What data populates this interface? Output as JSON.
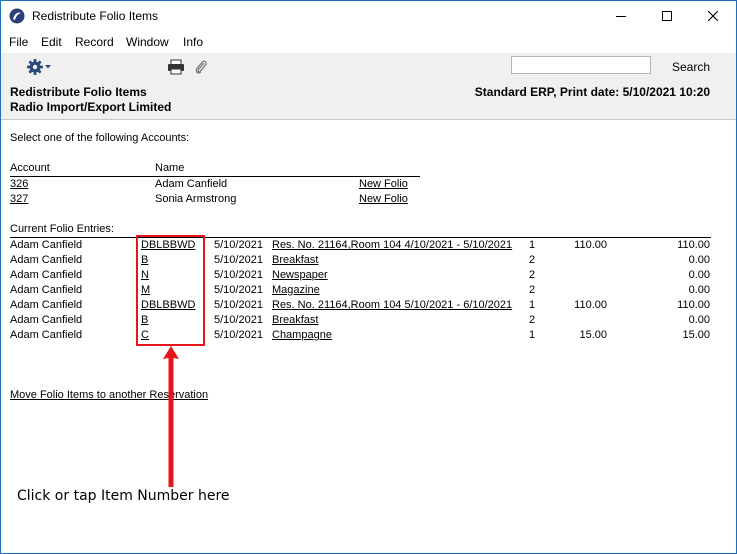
{
  "window": {
    "title": "Redistribute Folio Items"
  },
  "menu": [
    "File",
    "Edit",
    "Record",
    "Window",
    "Info"
  ],
  "toolbar": {
    "search_placeholder": "",
    "search_label": "Search"
  },
  "report_header": {
    "title": "Redistribute Folio Items",
    "company": "Radio Import/Export Limited",
    "print_info": "Standard ERP, Print date: 5/10/2021 10:20"
  },
  "accounts_section": {
    "prompt": "Select one of the following Accounts:",
    "col_account": "Account",
    "col_name": "Name",
    "rows": [
      {
        "account": "326",
        "name": "Adam Canfield",
        "action": "New Folio"
      },
      {
        "account": "327",
        "name": "Sonia Armstrong",
        "action": "New Folio"
      }
    ]
  },
  "entries_section": {
    "heading": "Current Folio Entries:",
    "rows": [
      {
        "name": "Adam Canfield",
        "item": "DBLBBWD",
        "date": "5/10/2021",
        "description": "Res. No. 21164,Room 104 4/10/2021 - 5/10/2021",
        "qty": "1",
        "price": "110.00",
        "amount": "110.00"
      },
      {
        "name": "Adam Canfield",
        "item": "B",
        "date": "5/10/2021",
        "description": "Breakfast",
        "qty": "2",
        "price": "",
        "amount": "0.00"
      },
      {
        "name": "Adam Canfield",
        "item": "N",
        "date": "5/10/2021",
        "description": "Newspaper",
        "qty": "2",
        "price": "",
        "amount": "0.00"
      },
      {
        "name": "Adam Canfield",
        "item": "M",
        "date": "5/10/2021",
        "description": "Magazine",
        "qty": "2",
        "price": "",
        "amount": "0.00"
      },
      {
        "name": "Adam Canfield",
        "item": "DBLBBWD",
        "date": "5/10/2021",
        "description": "Res. No. 21164,Room 104 5/10/2021 - 6/10/2021",
        "qty": "1",
        "price": "110.00",
        "amount": "110.00"
      },
      {
        "name": "Adam Canfield",
        "item": "B",
        "date": "5/10/2021",
        "description": "Breakfast",
        "qty": "2",
        "price": "",
        "amount": "0.00"
      },
      {
        "name": "Adam Canfield",
        "item": "C",
        "date": "5/10/2021",
        "description": "Champagne",
        "qty": "1",
        "price": "15.00",
        "amount": "15.00"
      }
    ]
  },
  "footer_link": "Move Folio Items to another Reservation",
  "annotation": {
    "label": "Click or tap Item Number here",
    "color": "#e4161b"
  },
  "colors": {
    "toolbar_bg": "#f0f0f0",
    "window_border": "#1b6fbd"
  }
}
